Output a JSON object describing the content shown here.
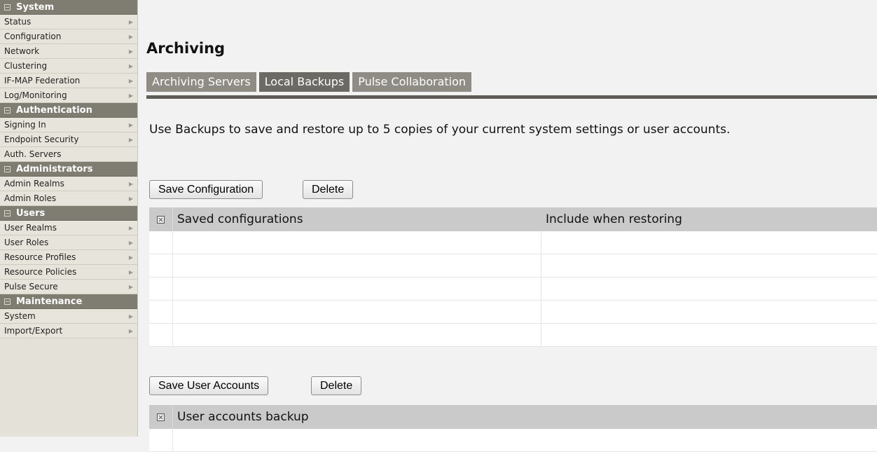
{
  "sidebar": {
    "sections": [
      {
        "title": "System",
        "items": [
          {
            "label": "Status"
          },
          {
            "label": "Configuration"
          },
          {
            "label": "Network"
          },
          {
            "label": "Clustering"
          },
          {
            "label": "IF-MAP Federation"
          },
          {
            "label": "Log/Monitoring"
          }
        ]
      },
      {
        "title": "Authentication",
        "items": [
          {
            "label": "Signing In"
          },
          {
            "label": "Endpoint Security"
          },
          {
            "label": "Auth. Servers"
          }
        ]
      },
      {
        "title": "Administrators",
        "items": [
          {
            "label": "Admin Realms"
          },
          {
            "label": "Admin Roles"
          }
        ]
      },
      {
        "title": "Users",
        "items": [
          {
            "label": "User Realms"
          },
          {
            "label": "User Roles"
          },
          {
            "label": "Resource Profiles"
          },
          {
            "label": "Resource Policies"
          },
          {
            "label": "Pulse Secure"
          }
        ]
      },
      {
        "title": "Maintenance",
        "items": [
          {
            "label": "System"
          },
          {
            "label": "Import/Export"
          }
        ]
      }
    ]
  },
  "main": {
    "title": "Archiving",
    "tabs": [
      {
        "label": "Archiving Servers",
        "active": false
      },
      {
        "label": "Local Backups",
        "active": true
      },
      {
        "label": "Pulse Collaboration",
        "active": false
      }
    ],
    "description": "Use Backups to save and restore up to 5 copies of your current system settings or user accounts.",
    "config_section": {
      "save_label": "Save Configuration",
      "delete_label": "Delete",
      "col_saved": "Saved configurations",
      "col_include": "Include when restoring"
    },
    "user_section": {
      "save_label": "Save User Accounts",
      "delete_label": "Delete",
      "col_backup": "User accounts backup"
    }
  },
  "colors": {
    "sidebar_header": "#7f7d72",
    "tab_bg": "#8e8c85",
    "tab_active": "#6c6a64",
    "grid_header": "#cacaca"
  }
}
